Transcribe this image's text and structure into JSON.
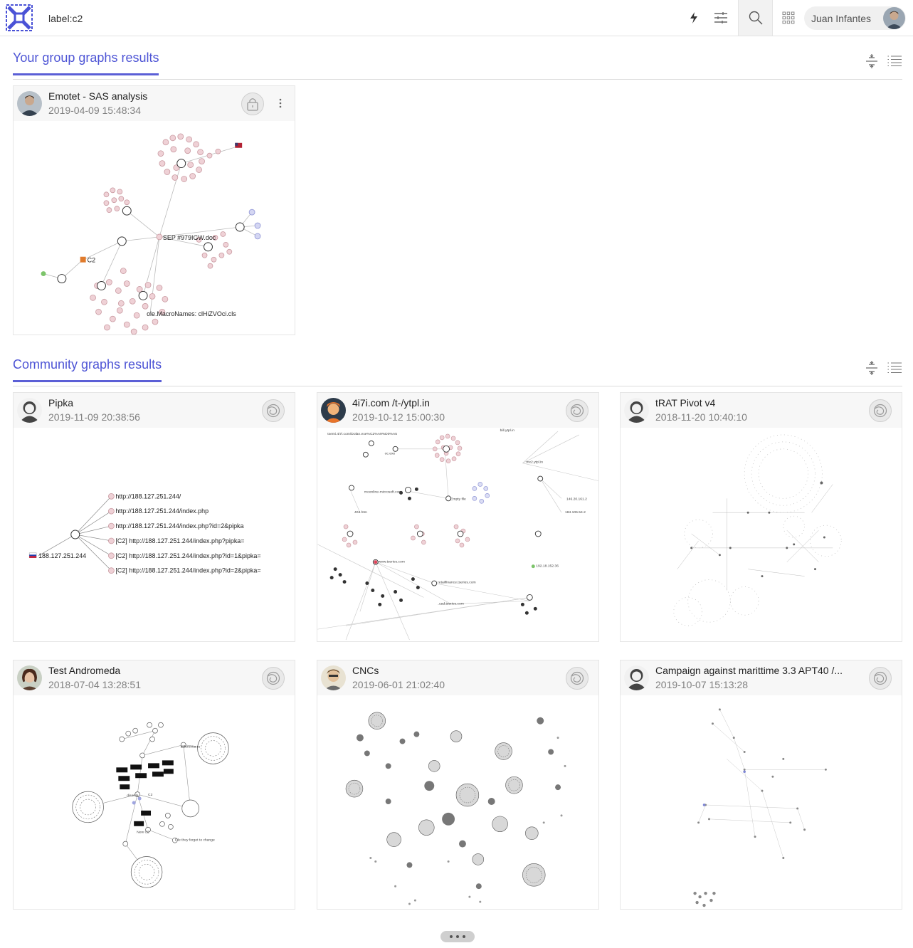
{
  "header": {
    "query": "label:c2",
    "user_name": "Juan Infantes",
    "icons": [
      "logo-icon",
      "bolt-icon",
      "sliders-icon",
      "search-icon",
      "apps-grid-icon"
    ]
  },
  "group_section": {
    "title": "Your group graphs results",
    "cards": [
      {
        "title": "Emotet - SAS analysis",
        "date": "2019-04-09 15:48:34",
        "badge": "lock-icon",
        "labels": {
          "sep": "SEP #979IGW.doc",
          "c2": "C2",
          "macro": "ole.MacroNames: clHiZVOci.cls"
        }
      }
    ]
  },
  "community_section": {
    "title": "Community graphs results",
    "cards": [
      {
        "title": "Pipka",
        "date": "2019-11-09 20:38:56",
        "badge": "community-icon",
        "labels": {
          "root": "188.127.251.244",
          "urls": [
            "http://188.127.251.244/",
            "http://188.127.251.244/index.php",
            "http://188.127.251.244/index.php?id=2&pipka",
            "[C2] http://188.127.251.244/index.php?pipka=",
            "[C2] http://188.127.251.244/index.php?id=1&pipka=",
            "[C2] http://188.127.251.244/index.php?id=2&pipka="
          ]
        }
      },
      {
        "title": "4i7i.com /t-/ytpl.in",
        "date": "2019-10-12 15:00:30",
        "badge": "community-icon",
        "labels": {
          "a": "tsemi.4i7i.com/Dolan.exe%C2%A9%D0%A5",
          "b": "oc.exe",
          "c": "bill.ytpl.in",
          "d": "mx2.ytpl.in",
          "e": "moonline-microsoft.com",
          "f": "Empty file",
          "g": "146.20.161.2",
          "h": "184.106.54.2",
          "i": "404.htm",
          "j": "www.tseries.com",
          "k": "192.18.152.36",
          "l": "retailfinance.tseries.com",
          "m": "ced.tseries.com"
        }
      },
      {
        "title": "tRAT Pivot v4",
        "date": "2018-11-20 10:40:10",
        "badge": "community-icon"
      },
      {
        "title": "Test Andromeda",
        "date": "2018-07-04 13:28:51",
        "badge": "community-icon",
        "labels": {
          "a": "differentia.ru",
          "b": "disorda",
          "c": "C2",
          "d": "New C2",
          "e": "File they forget to change"
        }
      },
      {
        "title": "CNCs",
        "date": "2019-06-01 21:02:40",
        "badge": "community-icon"
      },
      {
        "title": "Campaign against marittime 3.3 APT40 /...",
        "date": "2019-10-07 15:13:28",
        "badge": "community-icon"
      }
    ]
  },
  "footer": {
    "more_icon": "more-dots-icon"
  },
  "colors": {
    "accent": "#4d54d5",
    "node_pink": "#e8b4bb",
    "node_blue": "#a9aee6"
  }
}
